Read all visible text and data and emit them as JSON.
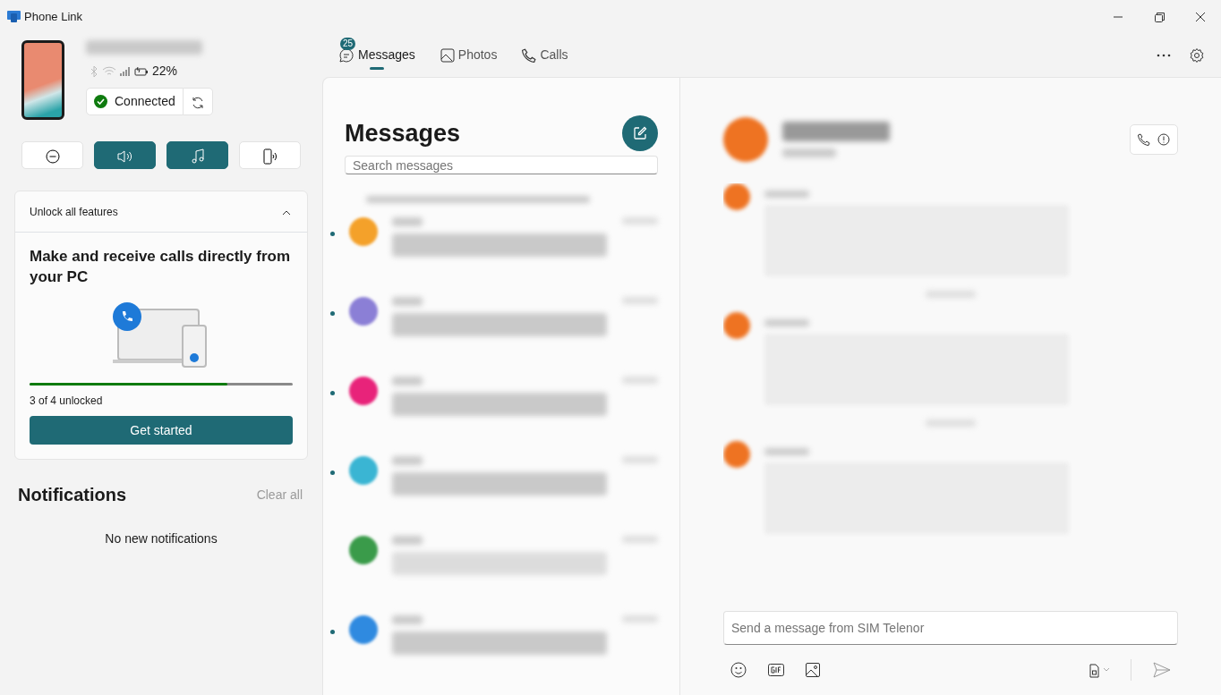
{
  "window": {
    "title": "Phone Link"
  },
  "device": {
    "battery": "22%",
    "status": "Connected"
  },
  "quick_actions": [
    {
      "kind": "dnd",
      "on": false
    },
    {
      "kind": "volume",
      "on": true
    },
    {
      "kind": "music",
      "on": true
    },
    {
      "kind": "phone-audio",
      "on": false
    }
  ],
  "feature_card": {
    "header": "Unlock all features",
    "expanded": true,
    "title": "Make and receive calls directly from your PC",
    "level": 0.75,
    "progress_text": "3 of 4 unlocked",
    "button": "Get started"
  },
  "notifications": {
    "title": "Notifications",
    "clear": "Clear all",
    "empty": "No new notifications"
  },
  "tabs": [
    {
      "label": "Messages",
      "badge": "25",
      "kind": "messages",
      "selected": true
    },
    {
      "label": "Photos",
      "kind": "photos",
      "selected": false
    },
    {
      "label": "Calls",
      "kind": "calls",
      "selected": false
    }
  ],
  "messages": {
    "title": "Messages",
    "search": {
      "placeholder": "Search messages"
    },
    "conversations": [
      {
        "color": "#f4a12a",
        "unread": true
      },
      {
        "color": "#8b7fd6",
        "unread": true
      },
      {
        "color": "#e8237a",
        "unread": true
      },
      {
        "color": "#3ab5d3",
        "unread": true
      },
      {
        "color": "#3a9b4a",
        "unread": false
      },
      {
        "color": "#2f8ae0",
        "unread": true
      }
    ]
  },
  "composer": {
    "placeholder": "Send a message from SIM Telenor"
  }
}
